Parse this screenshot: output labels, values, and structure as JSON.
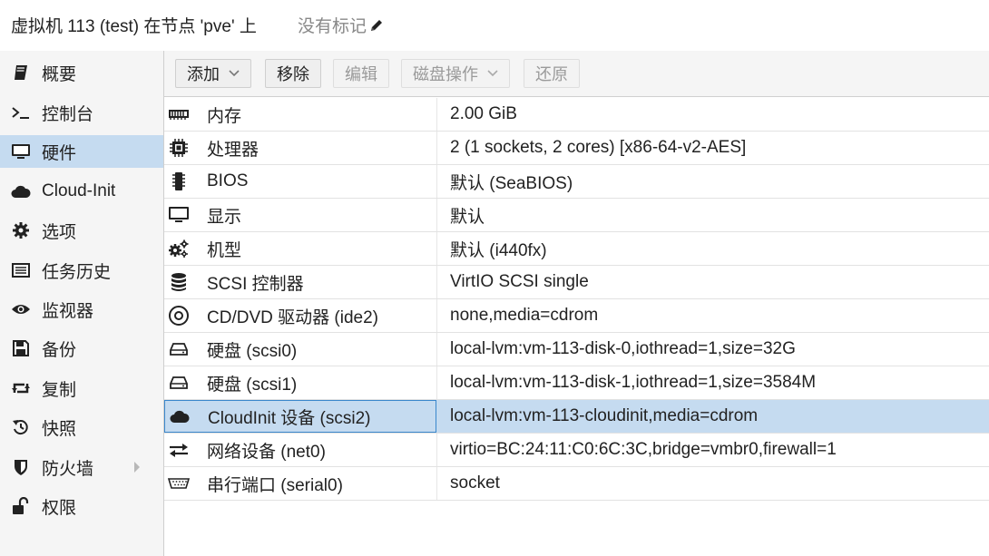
{
  "header": {
    "title": "虚拟机 113 (test) 在节点 'pve' 上",
    "tags": "没有标记"
  },
  "sidebar": {
    "items": [
      {
        "label": "概要",
        "icon": "book-icon"
      },
      {
        "label": "控制台",
        "icon": "terminal-icon"
      },
      {
        "label": "硬件",
        "icon": "monitor-icon",
        "active": true
      },
      {
        "label": "Cloud-Init",
        "icon": "cloud-icon"
      },
      {
        "label": "选项",
        "icon": "gear-icon"
      },
      {
        "label": "任务历史",
        "icon": "list-icon"
      },
      {
        "label": "监视器",
        "icon": "eye-icon"
      },
      {
        "label": "备份",
        "icon": "floppy-icon"
      },
      {
        "label": "复制",
        "icon": "retweet-icon"
      },
      {
        "label": "快照",
        "icon": "history-icon"
      },
      {
        "label": "防火墙",
        "icon": "shield-icon",
        "expandable": true
      },
      {
        "label": "权限",
        "icon": "unlock-icon"
      }
    ]
  },
  "toolbar": {
    "add": "添加",
    "remove": "移除",
    "edit": "编辑",
    "disk_action": "磁盘操作",
    "revert": "还原"
  },
  "hardware": [
    {
      "name": "内存",
      "value": "2.00 GiB",
      "icon": "memory-icon"
    },
    {
      "name": "处理器",
      "value": "2 (1 sockets, 2 cores) [x86-64-v2-AES]",
      "icon": "cpu-icon"
    },
    {
      "name": "BIOS",
      "value": "默认 (SeaBIOS)",
      "icon": "microchip-icon"
    },
    {
      "name": "显示",
      "value": "默认",
      "icon": "desktop-icon"
    },
    {
      "name": "机型",
      "value": "默认 (i440fx)",
      "icon": "cogs-icon"
    },
    {
      "name": "SCSI 控制器",
      "value": "VirtIO SCSI single",
      "icon": "database-icon"
    },
    {
      "name": "CD/DVD 驱动器 (ide2)",
      "value": "none,media=cdrom",
      "icon": "cdrom-icon"
    },
    {
      "name": "硬盘 (scsi0)",
      "value": "local-lvm:vm-113-disk-0,iothread=1,size=32G",
      "icon": "hdd-icon"
    },
    {
      "name": "硬盘 (scsi1)",
      "value": "local-lvm:vm-113-disk-1,iothread=1,size=3584M",
      "icon": "hdd-icon"
    },
    {
      "name": "CloudInit 设备 (scsi2)",
      "value": "local-lvm:vm-113-cloudinit,media=cdrom",
      "icon": "cloud-icon",
      "selected": true
    },
    {
      "name": "网络设备 (net0)",
      "value": "virtio=BC:24:11:C0:6C:3C,bridge=vmbr0,firewall=1",
      "icon": "exchange-icon"
    },
    {
      "name": "串行端口 (serial0)",
      "value": "socket",
      "icon": "serial-port-icon"
    }
  ],
  "colors": {
    "selection": "#c5dbf0",
    "selection_border": "#3a87cc",
    "sidebar_bg": "#f5f5f5"
  }
}
